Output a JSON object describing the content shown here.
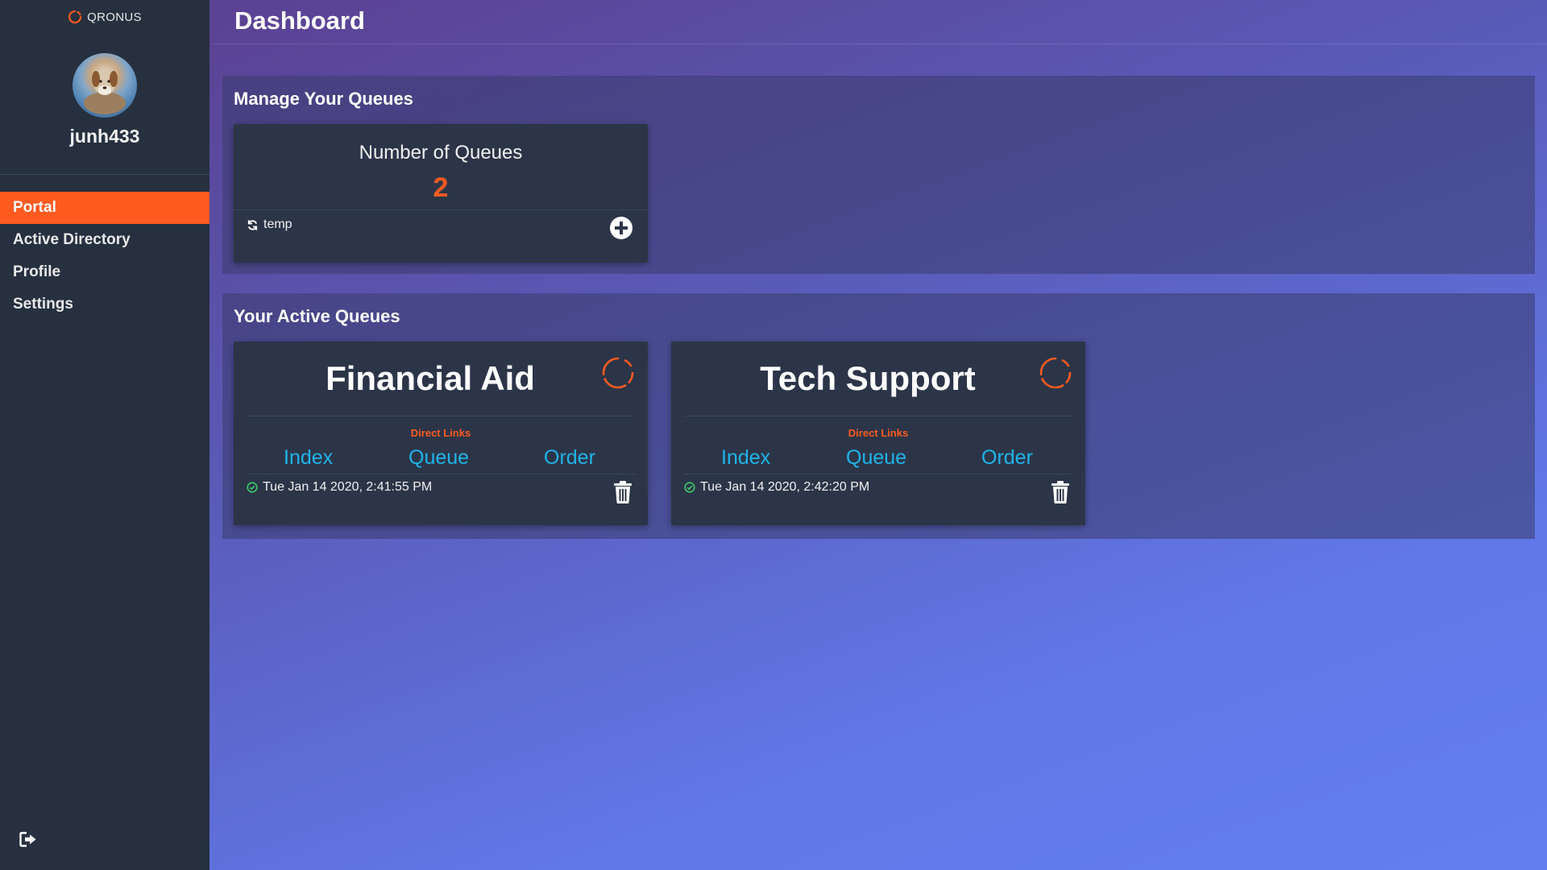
{
  "brand": {
    "name": "QRONUS",
    "icon": "qronus-spinner-logo",
    "accent": "#ff5a1f"
  },
  "user": {
    "username": "junh433",
    "avatar": "dog-avatar"
  },
  "sidebar": {
    "items": [
      {
        "label": "Portal",
        "active": true
      },
      {
        "label": "Active Directory",
        "active": false
      },
      {
        "label": "Profile",
        "active": false
      },
      {
        "label": "Settings",
        "active": false
      }
    ],
    "logout_icon": "sign-out-icon"
  },
  "header": {
    "title": "Dashboard"
  },
  "manage": {
    "title": "Manage Your Queues",
    "stats": {
      "label": "Number of Queues",
      "value": "2",
      "footer_text": "temp",
      "footer_icon": "refresh-icon",
      "add_icon": "plus-circle-icon"
    }
  },
  "active": {
    "title": "Your Active Queues",
    "queues": [
      {
        "name": "Financial Aid",
        "direct_links_label": "Direct Links",
        "links": [
          "Index",
          "Queue",
          "Order"
        ],
        "timestamp": "Tue Jan 14 2020, 2:41:55 PM"
      },
      {
        "name": "Tech Support",
        "direct_links_label": "Direct Links",
        "links": [
          "Index",
          "Queue",
          "Order"
        ],
        "timestamp": "Tue Jan 14 2020, 2:42:20 PM"
      }
    ]
  },
  "colors": {
    "sidebar_bg": "#26303f",
    "card_bg": "#2c3548",
    "active_nav": "#ff5a1f",
    "link": "#1fb4e8",
    "status_ok": "#3ec96b"
  }
}
